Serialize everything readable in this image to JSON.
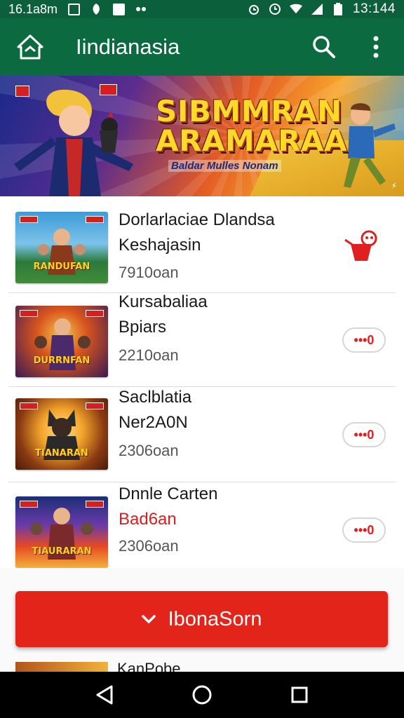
{
  "status_bar": {
    "left_text": "16.1a8m",
    "time": "13:144"
  },
  "app_bar": {
    "title": "Iindianasia",
    "icons": [
      "app-logo-icon",
      "search-icon",
      "more-vert-icon"
    ]
  },
  "banner": {
    "title_line1": "SIBMMRAN",
    "title_line2": "ARAMARAA",
    "subtitle": "Baldar Mulles Nonam"
  },
  "games": [
    {
      "name_line1": "Dorlarlaciae Dlandsa",
      "name_line2": "Keshajasin",
      "meta": "7910oan",
      "thumb_label": "RANDUFAN",
      "action": "red-hand-icon",
      "thumb_colors": [
        "#2c7a3a",
        "#3e9bd8"
      ]
    },
    {
      "name_line1": "Kursabaliaa",
      "name_line2": "Bpiars",
      "meta": "2210oan",
      "thumb_label": "DURRNFAN",
      "action": "•••0",
      "thumb_colors": [
        "#3a1a54",
        "#d89a2a"
      ]
    },
    {
      "name_line1": "Saclblatia",
      "name_line2": "Ner2A0N",
      "meta": "2306oan",
      "thumb_label": "TIANARAN",
      "action": "•••0",
      "thumb_colors": [
        "#4a1c08",
        "#f2a32a"
      ]
    },
    {
      "name_line1": "Dnnle Carten",
      "name_line2": "Bad6an",
      "meta": "2306oan",
      "thumb_label": "TIAURARAN",
      "action": "•••0",
      "thumb_colors": [
        "#1c2e78",
        "#e64a24"
      ]
    }
  ],
  "cta": {
    "label": "IbonaSorn"
  },
  "peek": {
    "text": "KanPobe"
  },
  "colors": {
    "status_bar": "#0b5f3a",
    "app_bar": "#0c6a40",
    "cta": "#e3241b",
    "accent_red": "#d32020"
  }
}
